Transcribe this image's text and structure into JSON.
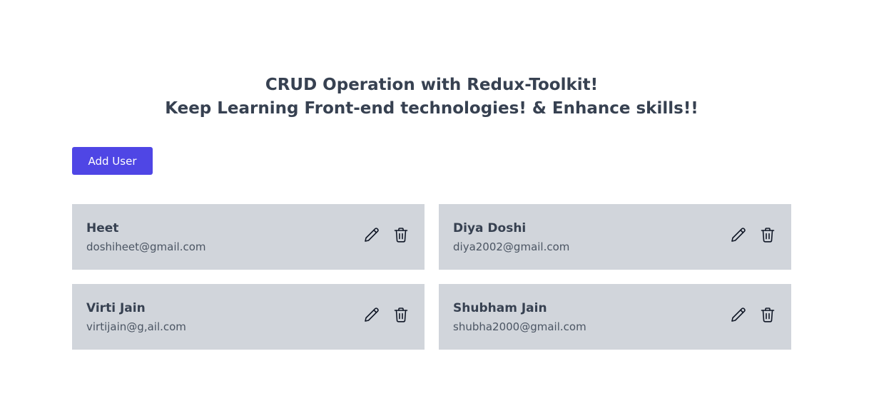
{
  "header": {
    "title_line1": "CRUD Operation with Redux-Toolkit!",
    "title_line2": "Keep Learning Front-end technologies! & Enhance skills!!"
  },
  "toolbar": {
    "add_user_label": "Add User"
  },
  "users": [
    {
      "name": "Heet",
      "email": "doshiheet@gmail.com",
      "edit_icon": "pencil-icon",
      "delete_icon": "trash-icon"
    },
    {
      "name": "Diya Doshi",
      "email": "diya2002@gmail.com",
      "edit_icon": "pencil-icon",
      "delete_icon": "trash-icon"
    },
    {
      "name": "Virti Jain",
      "email": "virtijain@g,ail.com",
      "edit_icon": "pencil-icon",
      "delete_icon": "trash-icon"
    },
    {
      "name": "Shubham Jain",
      "email": "shubha2000@gmail.com",
      "edit_icon": "pencil-icon",
      "delete_icon": "trash-icon"
    }
  ],
  "colors": {
    "accent": "#4f46e5",
    "card_background": "#d1d5db",
    "heading_text": "#374151"
  }
}
